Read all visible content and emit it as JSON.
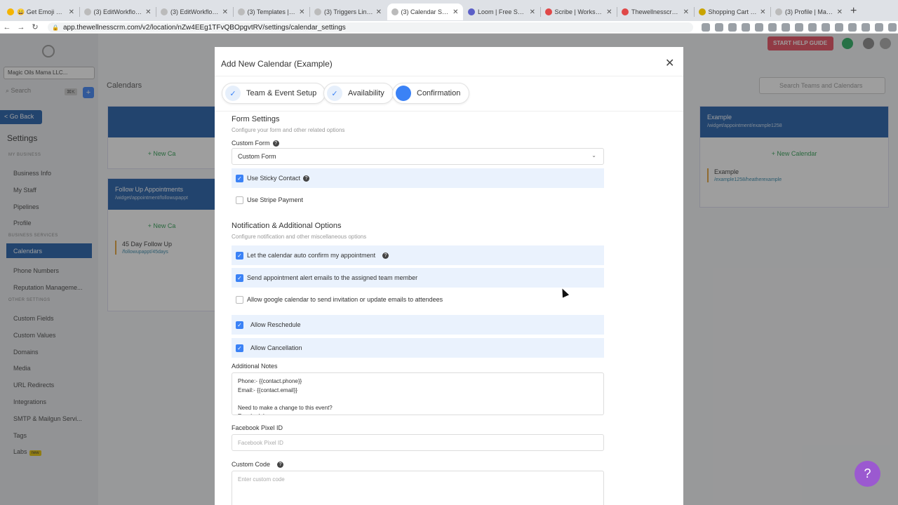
{
  "browser": {
    "tabs": [
      {
        "label": "😄 Get Emoji — All E",
        "active": false
      },
      {
        "label": "(3) EditWorkflow | M",
        "active": false
      },
      {
        "label": "(3) EditWorkflow | M",
        "active": false
      },
      {
        "label": "(3) Templates | Mag",
        "active": false
      },
      {
        "label": "(3) Triggers Links |",
        "active": false
      },
      {
        "label": "(3) Calendar Settin",
        "active": true
      },
      {
        "label": "Loom | Free Screen",
        "active": false
      },
      {
        "label": "Scribe | Workspace",
        "active": false
      },
      {
        "label": "Thewellnesscrm W",
        "active": false
      },
      {
        "label": "Shopping Cart | Wh",
        "active": false
      },
      {
        "label": "(3) Profile | Magic O",
        "active": false
      }
    ],
    "url": "app.thewellnesscrm.com/v2/location/nZw4EEg1TFvQBOpgvtRV/settings/calendar_settings",
    "profile_initial": "H"
  },
  "sidebar": {
    "account": "Magic Oils Mama LLC...",
    "search_placeholder": "Search",
    "search_kbd": "⌘K",
    "go_back": "< Go Back",
    "title": "Settings",
    "section_business": "MY BUSINESS",
    "section_business_services": "BUSINESS SERVICES",
    "section_other": "OTHER SETTINGS",
    "items_business": [
      "Business Info",
      "My Staff",
      "Pipelines",
      "Profile"
    ],
    "items_services": [
      "Calendars",
      "Phone Numbers",
      "Reputation Manageme..."
    ],
    "items_other": [
      "Custom Fields",
      "Custom Values",
      "Domains",
      "Media",
      "URL Redirects",
      "Integrations",
      "SMTP & Mailgun Servi...",
      "Tags",
      "Labs"
    ],
    "new_badge": "new"
  },
  "background": {
    "crumb": "Calendars",
    "search_placeholder": "Search Teams and Calendars",
    "help_guide": "START HELP GUIDE",
    "card_followup": {
      "title": "Follow Up Appointments",
      "sub": "/widget/appointment/followupappt",
      "new": "+ New Ca",
      "row": "45 Day Follow Up",
      "row_sub": "/followupappt/45days"
    },
    "card_example": {
      "title": "Example",
      "sub": "/widget/appointment/example1258",
      "new": "+ New Calendar",
      "row": "Example",
      "row_sub": "/example1258/heatherexample"
    },
    "card_top_new": "+ New Ca"
  },
  "modal": {
    "title": "Add New Calendar (Example)",
    "close_icon": "close-icon",
    "steps": [
      {
        "label": "Team & Event Setup",
        "state": "done"
      },
      {
        "label": "Availability",
        "state": "done"
      },
      {
        "label": "Confirmation",
        "state": "current"
      }
    ],
    "form_settings": {
      "title": "Form Settings",
      "subtitle": "Configure your form and other related options",
      "custom_form_label": "Custom Form",
      "custom_form_value": "Custom Form",
      "sticky_contact": "Use Sticky Contact",
      "stripe_payment": "Use Stripe Payment"
    },
    "notifications": {
      "title": "Notification & Additional Options",
      "subtitle": "Configure notification and other miscellaneous options",
      "auto_confirm": "Let the calendar auto confirm my appointment",
      "alert_emails": "Send appointment alert emails to the assigned team member",
      "google_invite": "Allow google calendar to send invitation or update emails to attendees",
      "allow_reschedule": "Allow Reschedule",
      "allow_cancellation": "Allow Cancellation"
    },
    "additional_notes_label": "Additional Notes",
    "additional_notes_value": "Phone:- {{contact.phone}}\nEmail:- {{contact.email}}\n\nNeed to make a change to this event?\nReschedule",
    "facebook_pixel_label": "Facebook Pixel ID",
    "facebook_pixel_placeholder": "Facebook Pixel ID",
    "custom_code_label": "Custom Code",
    "custom_code_placeholder": "Enter custom code"
  },
  "help_fab": "?",
  "colors": {
    "accent": "#3b82f6",
    "highlight_row": "#eaf2fd",
    "sidebar_active": "#1e5ba8",
    "help_fab": "#9b59d0"
  }
}
